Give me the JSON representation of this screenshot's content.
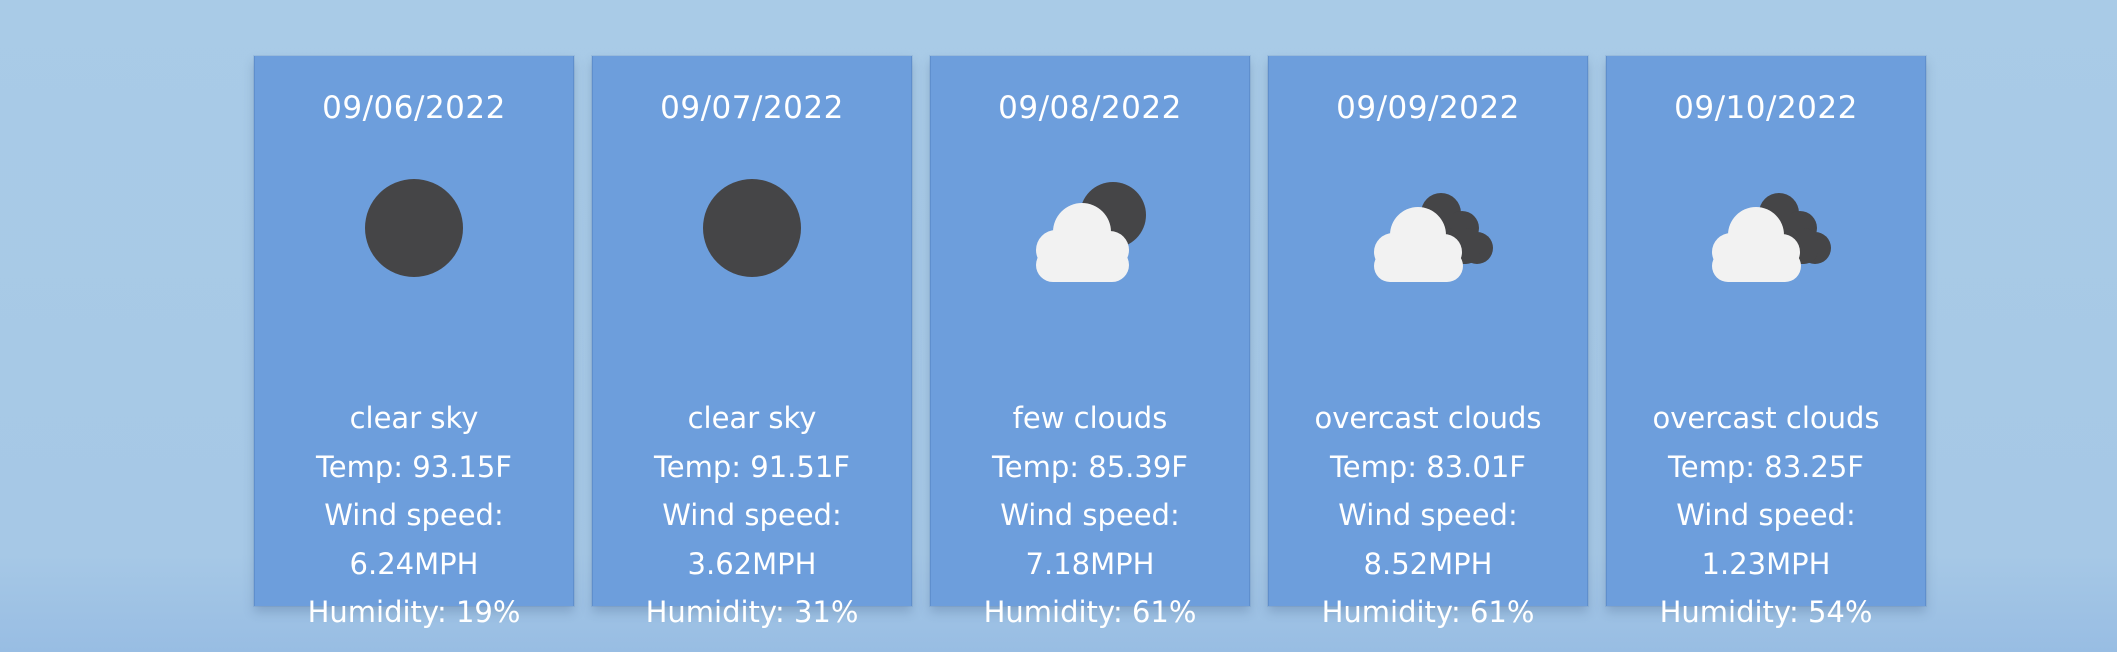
{
  "forecast": [
    {
      "date": "09/06/2022",
      "icon": "moon-icon",
      "description": "clear sky",
      "temp": "Temp: 93.15F",
      "wind_label": "Wind speed:",
      "wind_value": "6.24MPH",
      "humidity": "Humidity: 19%"
    },
    {
      "date": "09/07/2022",
      "icon": "moon-icon",
      "description": "clear sky",
      "temp": "Temp: 91.51F",
      "wind_label": "Wind speed:",
      "wind_value": "3.62MPH",
      "humidity": "Humidity: 31%"
    },
    {
      "date": "09/08/2022",
      "icon": "few-clouds-night-icon",
      "description": "few clouds",
      "temp": "Temp: 85.39F",
      "wind_label": "Wind speed:",
      "wind_value": "7.18MPH",
      "humidity": "Humidity: 61%"
    },
    {
      "date": "09/09/2022",
      "icon": "overcast-clouds-icon",
      "description": "overcast clouds",
      "temp": "Temp: 83.01F",
      "wind_label": "Wind speed:",
      "wind_value": "8.52MPH",
      "humidity": "Humidity: 61%"
    },
    {
      "date": "09/10/2022",
      "icon": "overcast-clouds-icon",
      "description": "overcast clouds",
      "temp": "Temp: 83.25F",
      "wind_label": "Wind speed:",
      "wind_value": "1.23MPH",
      "humidity": "Humidity: 54%"
    }
  ],
  "colors": {
    "card_background": "#6d9edc",
    "page_background": "#a9cbe7",
    "dark_icon": "#454547",
    "cloud": "#f2f2f2",
    "text": "#ffffff"
  }
}
